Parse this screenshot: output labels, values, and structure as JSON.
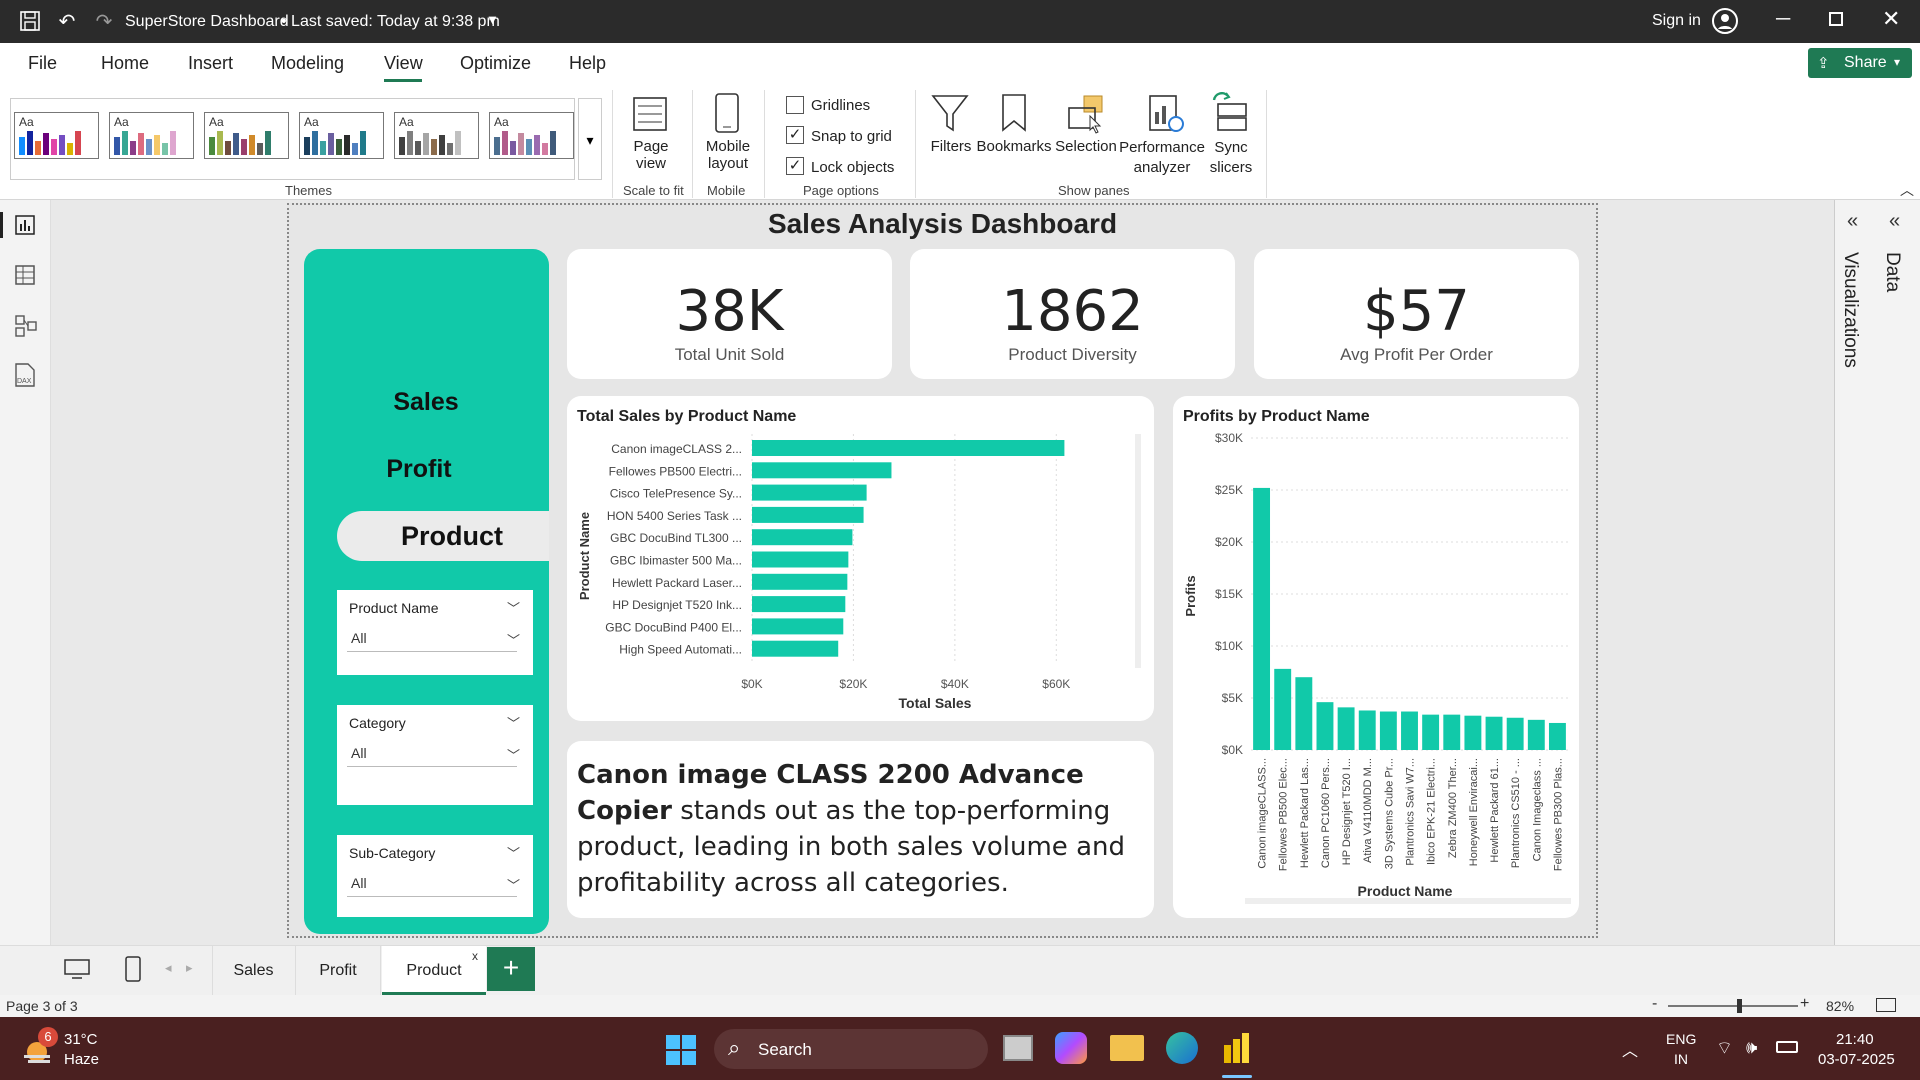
{
  "titlebar": {
    "title": "SuperStore Dashboard",
    "saved": "• Last saved: Today at 9:38 pm",
    "signin": "Sign in"
  },
  "ribbon_tabs": [
    "File",
    "Home",
    "Insert",
    "Modeling",
    "View",
    "Optimize",
    "Help"
  ],
  "active_tab": "View",
  "share_label": "Share",
  "ribbon": {
    "themes_label": "Themes",
    "theme_aa": "Aa",
    "page_view": "Page view",
    "scale_to_fit": "Scale to fit",
    "mobile_layout": "Mobile layout",
    "mobile": "Mobile",
    "gridlines": "Gridlines",
    "snap_to_grid": "Snap to grid",
    "lock_objects": "Lock objects",
    "page_options": "Page options",
    "filters": "Filters",
    "bookmarks": "Bookmarks",
    "selection": "Selection",
    "performance_analyzer": "Performance analyzer",
    "sync_slicers": "Sync slicers",
    "show_panes": "Show panes",
    "checkbox_states": {
      "gridlines": false,
      "snap_to_grid": true,
      "lock_objects": true
    }
  },
  "report": {
    "title": "Sales Analysis Dashboard",
    "nav": [
      "Sales",
      "Profit",
      "Product"
    ],
    "kpis": [
      {
        "value": "38K",
        "label": "Total Unit Sold"
      },
      {
        "value": "1862",
        "label": "Product Diversity"
      },
      {
        "value": "$57",
        "label": "Avg Profit Per Order"
      }
    ],
    "slicers": [
      {
        "title": "Product Name",
        "value": "All"
      },
      {
        "title": "Category",
        "value": "All"
      },
      {
        "title": "Sub-Category",
        "value": "All"
      }
    ],
    "insight_bold": "Canon image CLASS 2200 Advance Copier",
    "insight_rest": "stands out as the top-performing product, leading in both sales volume and profitability across all categories."
  },
  "chart_data": [
    {
      "type": "bar",
      "orientation": "horizontal",
      "title": "Total Sales by Product Name",
      "xlabel": "Total Sales",
      "ylabel": "Product Name",
      "categories": [
        "Canon imageCLASS 2...",
        "Fellowes PB500 Electri...",
        "Cisco TelePresence Sy...",
        "HON 5400 Series Task ...",
        "GBC DocuBind TL300 ...",
        "GBC Ibimaster 500 Ma...",
        "Hewlett Packard Laser...",
        "HP Designjet T520 Ink...",
        "GBC DocuBind P400 El...",
        "High Speed Automati..."
      ],
      "values": [
        61600,
        27500,
        22600,
        22000,
        19800,
        19000,
        18800,
        18400,
        18000,
        17000
      ],
      "xticks": [
        "$0K",
        "$20K",
        "$40K",
        "$60K"
      ],
      "xlim": [
        0,
        70000
      ],
      "color": "#11c9a9"
    },
    {
      "type": "bar",
      "orientation": "vertical",
      "title": "Profits by Product Name",
      "xlabel": "Product Name",
      "ylabel": "Profits",
      "categories": [
        "Canon imageCLASS...",
        "Fellowes PB500 Elec...",
        "Hewlett Packard Las...",
        "Canon PC1060 Pers...",
        "HP Designjet T520 I...",
        "Ativa V4110MDD M...",
        "3D Systems Cube Pr...",
        "Plantronics Savi W7...",
        "Ibico EPK-21 Electri...",
        "Zebra ZM400 Ther...",
        "Honeywell Enviracai...",
        "Hewlett Packard 61...",
        "Plantronics CS510 - ...",
        "Canon Imageclass ...",
        "Fellowes PB300 Plas..."
      ],
      "values": [
        25200,
        7800,
        7000,
        4600,
        4100,
        3800,
        3700,
        3700,
        3400,
        3400,
        3300,
        3200,
        3100,
        2900,
        2600
      ],
      "yticks": [
        "$0K",
        "$5K",
        "$10K",
        "$15K",
        "$20K",
        "$25K",
        "$30K"
      ],
      "ylim": [
        0,
        30000
      ],
      "color": "#11c9a9"
    }
  ],
  "panes": {
    "visualizations": "Visualizations",
    "data": "Data"
  },
  "pages": [
    "Sales",
    "Profit",
    "Product"
  ],
  "active_page": "Product",
  "status": {
    "page": "Page 3 of 3",
    "zoom": "82%",
    "zoom_level": 0.55
  },
  "taskbar": {
    "temp": "31°C",
    "weather": "Haze",
    "badge": "6",
    "search": "Search",
    "lang1": "ENG",
    "lang2": "IN",
    "time": "21:40",
    "date": "03-07-2025"
  },
  "colors": {
    "accent": "#11c9a9",
    "titlebar": "#2b2b2b",
    "share": "#1f7a54",
    "taskbar": "#4a2020"
  }
}
